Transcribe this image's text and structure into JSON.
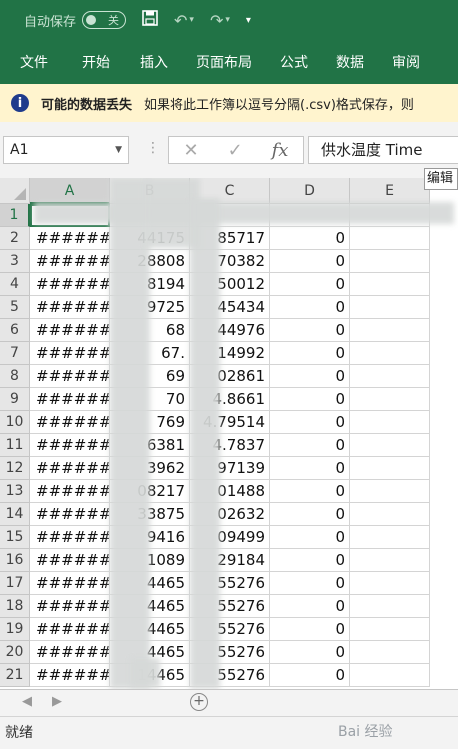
{
  "titlebar": {
    "autosave_label": "自动保存",
    "toggle_label": "关",
    "icons": [
      "save-icon",
      "undo-icon",
      "redo-icon",
      "customize-icon"
    ]
  },
  "tabs": [
    "文件",
    "开始",
    "插入",
    "页面布局",
    "公式",
    "数据",
    "审阅"
  ],
  "message_bar": {
    "title": "可能的数据丢失",
    "text": "如果将此工作簿以逗号分隔(.csv)格式保存，则"
  },
  "formula_bar": {
    "name_box": "A1",
    "cancel_glyph": "✕",
    "enter_glyph": "✓",
    "fx_label": "fx",
    "value": "供水温度 Time",
    "edit_tooltip": "编辑"
  },
  "grid": {
    "columns": [
      "A",
      "B",
      "C",
      "D",
      "E"
    ],
    "row_numbers": [
      "1",
      "2",
      "3",
      "4",
      "5",
      "6",
      "7",
      "8",
      "9",
      "10",
      "11",
      "12",
      "13",
      "14",
      "15",
      "16",
      "17",
      "18",
      "19",
      "20",
      "21"
    ],
    "rows": [
      [
        "",
        "",
        "",
        "",
        ""
      ],
      [
        "######",
        "44175",
        "85717",
        "0",
        ""
      ],
      [
        "######",
        "28808",
        "70382",
        "0",
        ""
      ],
      [
        "######",
        "8194",
        "50012",
        "0",
        ""
      ],
      [
        "######",
        "9725",
        "45434",
        "0",
        ""
      ],
      [
        "######",
        "68",
        "44976",
        "0",
        ""
      ],
      [
        "######",
        "67.",
        "14992",
        "0",
        ""
      ],
      [
        "######",
        "69",
        "02861",
        "0",
        ""
      ],
      [
        "######",
        "70",
        "4.8661",
        "0",
        ""
      ],
      [
        "######",
        "769",
        "4.79514",
        "0",
        ""
      ],
      [
        "######",
        "6381",
        "4.7837",
        "0",
        ""
      ],
      [
        "######",
        "3962",
        "97139",
        "0",
        ""
      ],
      [
        "######",
        "08217",
        "01488",
        "0",
        ""
      ],
      [
        "######",
        "33875",
        "02632",
        "0",
        ""
      ],
      [
        "######",
        "9416",
        "09499",
        "0",
        ""
      ],
      [
        "######",
        "1089",
        "29184",
        "0",
        ""
      ],
      [
        "######",
        "4465",
        "55276",
        "0",
        ""
      ],
      [
        "######",
        "4465",
        "55276",
        "0",
        ""
      ],
      [
        "######",
        "4465",
        "55276",
        "0",
        ""
      ],
      [
        "######",
        "4465",
        "55276",
        "0",
        ""
      ],
      [
        "######",
        "14465",
        "55276",
        "0",
        ""
      ]
    ]
  },
  "sheet_bar": {
    "add_label": "+"
  },
  "status": {
    "text": "就绪"
  },
  "watermark": "Bai 经验",
  "colors": {
    "accent": "#217346",
    "message_bg": "#fff4ce"
  }
}
